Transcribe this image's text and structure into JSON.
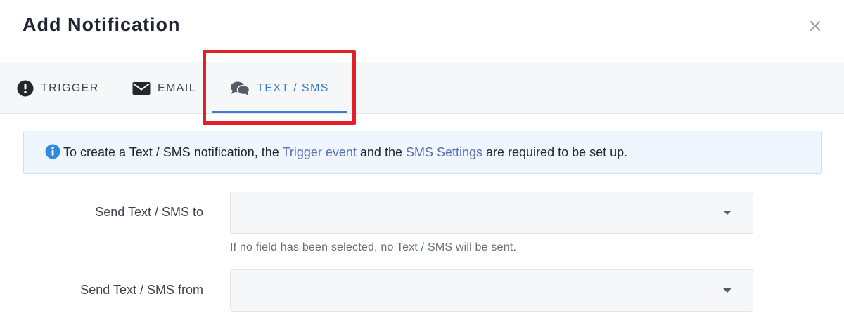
{
  "modal": {
    "title": "Add Notification",
    "close_icon": "close-icon"
  },
  "tabs": [
    {
      "label": "TRIGGER",
      "icon": "exclamation-circle-icon",
      "active": false
    },
    {
      "label": "EMAIL",
      "icon": "envelope-icon",
      "active": false
    },
    {
      "label": "TEXT / SMS",
      "icon": "chat-bubbles-icon",
      "active": true
    }
  ],
  "colors": {
    "accent": "#3b7bd4",
    "highlight": "#e0202b",
    "link": "#5a6fb8",
    "info_bg": "#f0f6fd"
  },
  "info": {
    "icon": "info-circle-icon",
    "text_before": "To create a Text / SMS notification, the ",
    "link_trigger": "Trigger event",
    "text_middle": " and the ",
    "link_settings": "SMS Settings",
    "text_after": " are required to be set up."
  },
  "form": {
    "send_to": {
      "label": "Send Text / SMS to",
      "value": "",
      "help": "If no field has been selected, no Text / SMS will be sent."
    },
    "send_from": {
      "label": "Send Text / SMS from",
      "value": ""
    }
  }
}
